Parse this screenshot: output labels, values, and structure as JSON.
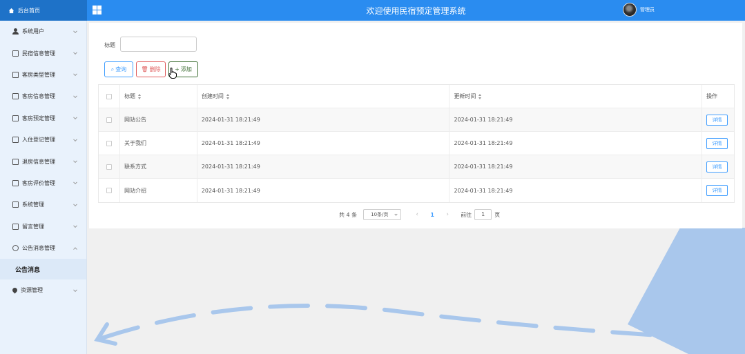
{
  "header": {
    "home_label": "后台首页",
    "site_title": "欢迎使用民宿预定管理系统",
    "user_label": "管理员"
  },
  "sidebar": {
    "items": [
      {
        "label": "系统用户",
        "icon": "person-icon"
      },
      {
        "label": "民宿信息管理",
        "icon": "edit-icon"
      },
      {
        "label": "客房类型管理",
        "icon": "edit-icon"
      },
      {
        "label": "客房信息管理",
        "icon": "edit-icon"
      },
      {
        "label": "客房预定管理",
        "icon": "edit-icon"
      },
      {
        "label": "入住登记管理",
        "icon": "edit-icon"
      },
      {
        "label": "退房信息管理",
        "icon": "edit-icon"
      },
      {
        "label": "客房评价管理",
        "icon": "edit-icon"
      },
      {
        "label": "系统管理",
        "icon": "picture-icon"
      },
      {
        "label": "留言管理",
        "icon": "picture-icon"
      },
      {
        "label": "公告消息管理",
        "icon": "info-icon"
      }
    ],
    "active_sub": "公告消息",
    "last_item": {
      "label": "资源管理",
      "icon": "location-icon"
    }
  },
  "search": {
    "label": "标题",
    "value": ""
  },
  "buttons": {
    "query": "查询",
    "delete": "删除",
    "add": "添加"
  },
  "table": {
    "headers": {
      "title": "标题",
      "created": "创建时间",
      "updated": "更新时间",
      "op": "操作"
    },
    "rows": [
      {
        "title": "网站公告",
        "created": "2024-01-31 18:21:49",
        "updated": "2024-01-31 18:21:49",
        "action": "详情"
      },
      {
        "title": "关于我们",
        "created": "2024-01-31 18:21:49",
        "updated": "2024-01-31 18:21:49",
        "action": "详情"
      },
      {
        "title": "联系方式",
        "created": "2024-01-31 18:21:49",
        "updated": "2024-01-31 18:21:49",
        "action": "详情"
      },
      {
        "title": "网站介绍",
        "created": "2024-01-31 18:21:49",
        "updated": "2024-01-31 18:21:49",
        "action": "详情"
      }
    ]
  },
  "pagination": {
    "total": "共 4 条",
    "page_size": "10条/页",
    "prev": "‹",
    "current": "1",
    "next": "›",
    "goto_label": "前往",
    "goto_value": "1",
    "page_suffix": "页"
  },
  "colors": {
    "header_left": "#1e72c8",
    "header": "#2a8cf0",
    "sidebar": "#e9f2fc",
    "primary": "#409eff",
    "danger": "#e05c5c",
    "add": "#3a6b2f"
  }
}
